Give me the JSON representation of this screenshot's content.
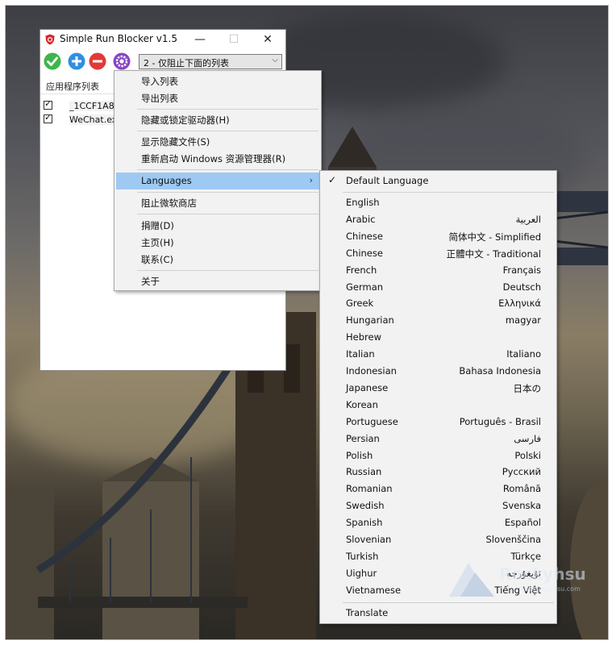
{
  "window": {
    "title": "Simple Run Blocker v1.5",
    "minimize_glyph": "—",
    "maximize_glyph": "☐",
    "close_glyph": "✕"
  },
  "toolbar": {
    "mode_select_value": "2 - 仅阻止下面的列表",
    "dropdown_glyph": "⌵"
  },
  "list": {
    "column_header": "应用程序列表",
    "rows": [
      {
        "label": "_1CCF1A8C",
        "checked": true
      },
      {
        "label": "WeChat.exe",
        "checked": true
      }
    ]
  },
  "icons": {
    "app": "shield-stop-icon",
    "allow": "green-check-circle-icon",
    "add": "blue-plus-circle-icon",
    "remove": "red-minus-circle-icon",
    "options": "purple-gear-icon"
  },
  "colors": {
    "allow": "#3db54a",
    "add": "#2f8fe0",
    "remove": "#e03a36",
    "options": "#8a44c8",
    "highlight": "#9ec9f2"
  },
  "options_menu": {
    "items": [
      {
        "label": "导入列表"
      },
      {
        "label": "导出列表"
      },
      {
        "label": "隐藏或锁定驱动器(H)"
      },
      {
        "label": "显示隐藏文件(S)"
      },
      {
        "label": "重新启动 Windows 资源管理器(R)"
      },
      {
        "label": "Languages",
        "submenu_glyph": "›"
      },
      {
        "label": "阻止微软商店"
      },
      {
        "label": "捐赠(D)"
      },
      {
        "label": "主页(H)"
      },
      {
        "label": "联系(C)"
      },
      {
        "label": "关于"
      }
    ]
  },
  "languages_menu": {
    "check_glyph": "✓",
    "default_label": "Default Language",
    "items": [
      {
        "name": "English",
        "native": ""
      },
      {
        "name": "Arabic",
        "native": "العربية"
      },
      {
        "name": "Chinese",
        "native": "简体中文 - Simplified"
      },
      {
        "name": "Chinese",
        "native": "正體中文 - Traditional"
      },
      {
        "name": "French",
        "native": "Français"
      },
      {
        "name": "German",
        "native": "Deutsch"
      },
      {
        "name": "Greek",
        "native": "Ελληνικά"
      },
      {
        "name": "Hungarian",
        "native": "magyar"
      },
      {
        "name": "Hebrew",
        "native": ""
      },
      {
        "name": "Italian",
        "native": "Italiano"
      },
      {
        "name": "Indonesian",
        "native": "Bahasa Indonesia"
      },
      {
        "name": "Japanese",
        "native": "日本の"
      },
      {
        "name": "Korean",
        "native": ""
      },
      {
        "name": "Portuguese",
        "native": "Português - Brasil"
      },
      {
        "name": "Persian",
        "native": "فارسی"
      },
      {
        "name": "Polish",
        "native": "Polski"
      },
      {
        "name": "Russian",
        "native": "Русский"
      },
      {
        "name": "Romanian",
        "native": "Română"
      },
      {
        "name": "Swedish",
        "native": "Svenska"
      },
      {
        "name": "Spanish",
        "native": "Español"
      },
      {
        "name": "Slovenian",
        "native": "Slovenščina"
      },
      {
        "name": "Turkish",
        "native": "Türkçe"
      },
      {
        "name": "Uighur",
        "native": "ئۇيغۇرچە"
      },
      {
        "name": "Vietnamese",
        "native": "Tiếng Việt"
      }
    ],
    "translate_label": "Translate"
  },
  "watermark": {
    "brand": "Rockyhsu",
    "site": "www.rockyhsu.com"
  }
}
